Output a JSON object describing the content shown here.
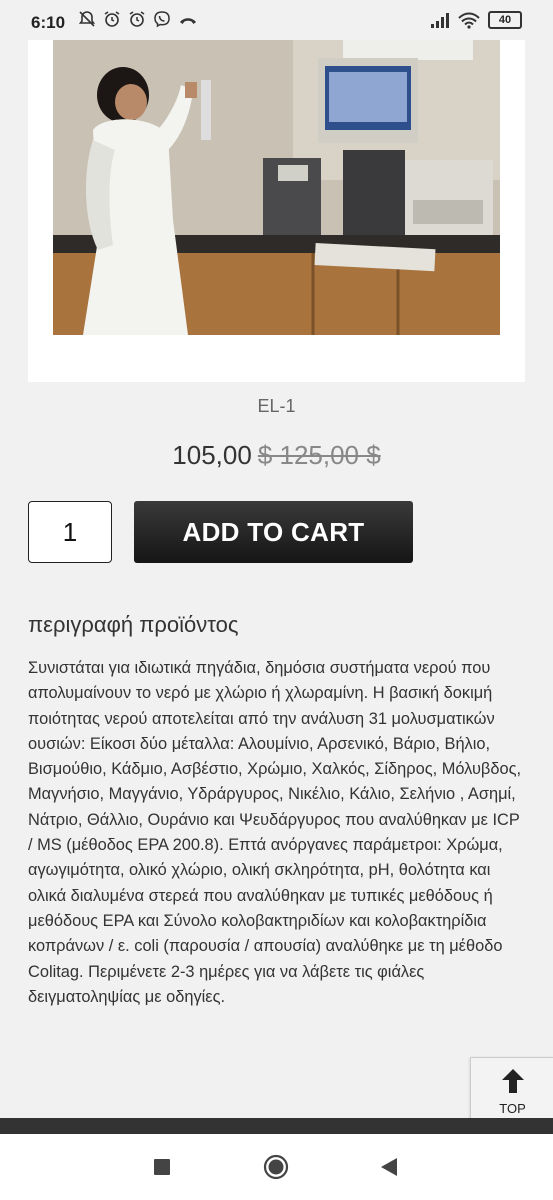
{
  "status_bar": {
    "time": "6:10",
    "battery": "40"
  },
  "product": {
    "sku": "EL-1",
    "price": "105,00",
    "old_price": "$ 125,00 $",
    "quantity": "1",
    "add_to_cart_label": "ADD TO CART"
  },
  "description": {
    "title": "περιγραφή προϊόντος",
    "text": "Συνιστάται για ιδιωτικά πηγάδια, δημόσια συστήματα νερού που απολυμαίνουν το νερό με χλώριο ή χλωραμίνη. Η βασική δοκιμή ποιότητας νερού αποτελείται από την ανάλυση 31 μολυσματικών ουσιών: Είκοσι δύο μέταλλα: Αλουμίνιο, Αρσενικό, Βάριο, Βήλιο, Βισμούθιο, Κάδμιο, Ασβέστιο, Χρώμιο, Χαλκός, Σίδηρος, Μόλυβδος, Μαγνήσιο, Μαγγάνιο, Υδράργυρος, Νικέλιο, Κάλιο, Σελήνιο , Ασημί, Νάτριο, Θάλλιο, Ουράνιο και Ψευδάργυρος που αναλύθηκαν με ICP / MS (μέθοδος EPA 200.8). Επτά ανόργανες παράμετροι: Χρώμα, αγωγιμότητα, ολικό χλώριο, ολική σκληρότητα, pH, θολότητα και ολικά διαλυμένα στερεά που αναλύθηκαν με τυπικές μεθόδους ή μεθόδους EPA και Σύνολο κολοβακτηριδίων και κολοβακτηρίδια κοπράνων / ε. coli (παρουσία / απουσία) αναλύθηκε με τη μέθοδο Colitag. Περιμένετε 2-3 ημέρες για να λάβετε τις φιάλες δειγματοληψίας με οδηγίες."
  },
  "back_to_top": {
    "label": "TOP"
  },
  "colors": {
    "page_background": "#f1f1f1",
    "button_dark": "#1e1e1e",
    "footer_bar": "#333333"
  }
}
